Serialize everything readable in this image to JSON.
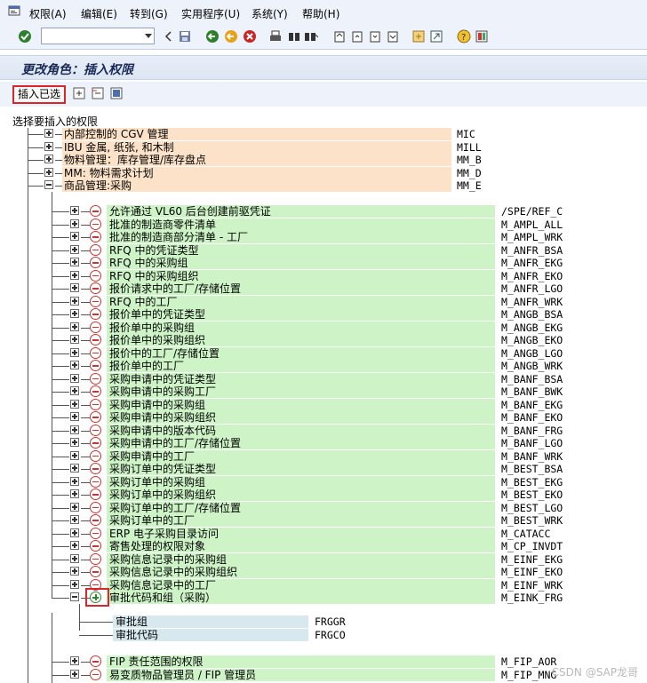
{
  "menu": {
    "items": [
      {
        "label": "权限(A)"
      },
      {
        "label": "编辑(E)"
      },
      {
        "label": "转到(G)"
      },
      {
        "label": "实用程序(U)"
      },
      {
        "label": "系统(Y)"
      },
      {
        "label": "帮助(H)"
      }
    ]
  },
  "toolbar": {
    "command_value": "",
    "icons": [
      "enter-icon",
      "back-nav-icon",
      "save-icon",
      "back-icon",
      "exit-icon",
      "cancel-icon",
      "print-icon",
      "find-icon",
      "find-next-icon",
      "first-page-icon",
      "prev-page-icon",
      "next-page-icon",
      "last-page-icon",
      "new-session-icon",
      "shortcut-icon",
      "help-icon",
      "layout-icon"
    ]
  },
  "title": "更改角色：插入权限",
  "app_toolbar": {
    "insert_label": "插入已选"
  },
  "tree": {
    "heading": "选择要插入的权限",
    "top_nodes": [
      {
        "label": "内部控制的 CGV 管理",
        "code": "MIC"
      },
      {
        "label": "IBU 金属, 纸张, 和木制",
        "code": "MILL"
      },
      {
        "label": "物料管理：库存管理/库存盘点",
        "code": "MM_B"
      },
      {
        "label": "MM: 物料需求计划",
        "code": "MM_D"
      },
      {
        "label": "商品管理:采购",
        "code": "MM_E"
      }
    ],
    "children": [
      {
        "label": "允许通过 VL60 后台创建前驱凭证",
        "code": "/SPE/REF_C"
      },
      {
        "label": "批准的制造商零件清单",
        "code": "M_AMPL_ALL"
      },
      {
        "label": "批准的制造商部分清单 - 工厂",
        "code": "M_AMPL_WRK"
      },
      {
        "label": "RFQ 中的凭证类型",
        "code": "M_ANFR_BSA"
      },
      {
        "label": "RFQ 中的采购组",
        "code": "M_ANFR_EKG"
      },
      {
        "label": "RFQ 中的采购组织",
        "code": "M_ANFR_EKO"
      },
      {
        "label": "报价请求中的工厂/存储位置",
        "code": "M_ANFR_LGO"
      },
      {
        "label": "RFQ 中的工厂",
        "code": "M_ANFR_WRK"
      },
      {
        "label": "报价单中的凭证类型",
        "code": "M_ANGB_BSA"
      },
      {
        "label": "报价单中的采购组",
        "code": "M_ANGB_EKG"
      },
      {
        "label": "报价单中的采购组织",
        "code": "M_ANGB_EKO"
      },
      {
        "label": "报价中的工厂/存储位置",
        "code": "M_ANGB_LGO"
      },
      {
        "label": "报价单中的工厂",
        "code": "M_ANGB_WRK"
      },
      {
        "label": "采购申请中的凭证类型",
        "code": "M_BANF_BSA"
      },
      {
        "label": "采购申请中的采购工厂",
        "code": "M_BANF_BWK"
      },
      {
        "label": "采购申请中的采购组",
        "code": "M_BANF_EKG"
      },
      {
        "label": "采购申请中的采购组织",
        "code": "M_BANF_EKO"
      },
      {
        "label": "采购申请中的版本代码",
        "code": "M_BANF_FRG"
      },
      {
        "label": "采购申请中的工厂/存储位置",
        "code": "M_BANF_LGO"
      },
      {
        "label": "采购申请中的工厂",
        "code": "M_BANF_WRK"
      },
      {
        "label": "采购订单中的凭证类型",
        "code": "M_BEST_BSA"
      },
      {
        "label": "采购订单中的采购组",
        "code": "M_BEST_EKG"
      },
      {
        "label": "采购订单中的采购组织",
        "code": "M_BEST_EKO"
      },
      {
        "label": "采购订单中的工厂/存储位置",
        "code": "M_BEST_LGO"
      },
      {
        "label": "采购订单中的工厂",
        "code": "M_BEST_WRK"
      },
      {
        "label": "ERP 电子采购目录访问",
        "code": "M_CATACC"
      },
      {
        "label": "寄售处理的权限对象",
        "code": "M_CP_INVDT"
      },
      {
        "label": "采购信息记录中的采购组",
        "code": "M_EINF_EKG"
      },
      {
        "label": "采购信息记录中的采购组织",
        "code": "M_EINF_EKO"
      },
      {
        "label": "采购信息记录中的工厂",
        "code": "M_EINF_WRK"
      },
      {
        "label": "审批代码和组（采购）",
        "code": "M_EINK_FRG"
      }
    ],
    "expanded_fields": [
      {
        "label": "审批组",
        "code": "FRGGR"
      },
      {
        "label": "审批代码",
        "code": "FRGCO"
      }
    ],
    "after_nodes": [
      {
        "label": "FIP 责任范围的权限",
        "code": "M_FIP_AOR"
      },
      {
        "label": "易变质物品管理员 / FIP 管理员",
        "code": "M_FIP_MNG"
      }
    ]
  },
  "watermark": "CSDN @SAP龙哥",
  "colors": {
    "orange_highlight": "#fbe2c8",
    "green_highlight": "#cdf3c7",
    "field_highlight": "#d7e9ee",
    "red_accent": "#d9262c"
  }
}
